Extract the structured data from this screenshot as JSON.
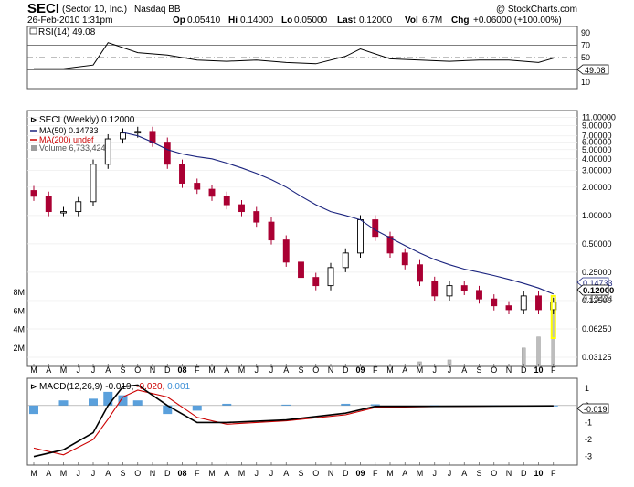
{
  "header": {
    "symbol": "SECI",
    "company": "(Sector 10, Inc.)",
    "exchange": "Nasdaq BB",
    "copyright": "@ StockCharts.com",
    "datetime": "26-Feb-2010 1:31pm",
    "op_label": "Op",
    "op": "0.05410",
    "hi_label": "Hi",
    "hi": "0.14000",
    "lo_label": "Lo",
    "lo": "0.05000",
    "last_label": "Last",
    "last": "0.12000",
    "vol_label": "Vol",
    "vol": "6.7M",
    "chg_label": "Chg",
    "chg": "+0.06000 (+100.00%)"
  },
  "rsi": {
    "label": "RSI(14) 49.08",
    "value_badge": "49.08",
    "levels": [
      "90",
      "70",
      "50",
      "30",
      "10"
    ]
  },
  "price_legend": {
    "line1": "SECI (Weekly) 0.12000",
    "line2": "MA(50) 0.14733",
    "line3": "MA(200) undef",
    "line4": "Volume 6,733,424"
  },
  "price_axis_labels": [
    "11.00000",
    "9.00000",
    "7.00000",
    "6.00000",
    "5.00000",
    "4.00000",
    "3.00000",
    "2.00000",
    "1.00000",
    "0.50000",
    "0.25000",
    "0.12500",
    "0.06250",
    "0.03125"
  ],
  "price_axis_values": [
    11,
    9,
    7,
    6,
    5,
    4,
    3,
    2,
    1,
    0.5,
    0.25,
    0.125,
    0.0625,
    0.03125
  ],
  "price_badges": {
    "ma": "0.14733",
    "last": "0.12000",
    "partial": "0.13424"
  },
  "volume_axis_labels": [
    "8M",
    "6M",
    "4M",
    "2M"
  ],
  "x_axis_labels": [
    "M",
    "A",
    "M",
    "J",
    "J",
    "A",
    "S",
    "O",
    "N",
    "D",
    "08",
    "F",
    "M",
    "A",
    "M",
    "J",
    "J",
    "A",
    "S",
    "O",
    "N",
    "D",
    "09",
    "F",
    "M",
    "A",
    "M",
    "J",
    "J",
    "A",
    "S",
    "O",
    "N",
    "D",
    "10",
    "F"
  ],
  "macd": {
    "label_prefix": "MACD(12,26,9)",
    "val1": "-0.019,",
    "val2": "-0.020,",
    "val3": "0.001",
    "badge": "-0.019",
    "levels": [
      "1",
      "0",
      "-1",
      "-2",
      "-3"
    ]
  },
  "colors": {
    "up": "#000000",
    "down": "#aa0033",
    "ma50": "#1a237e",
    "ma200": "#cc0000",
    "volume": "#bdbdbd",
    "volume_down": "#e57373",
    "macd_hist": "#3d8fd6",
    "signal": "#cc0000",
    "macd": "#000000",
    "highlight": "#ffff00"
  },
  "chart_data": [
    {
      "type": "line",
      "title": "RSI(14) 49.08",
      "ylim": [
        0,
        100
      ],
      "x": [
        "2007-03",
        "2007-05",
        "2007-07",
        "2007-08",
        "2007-10",
        "2007-12",
        "2008-02",
        "2008-04",
        "2008-06",
        "2008-08",
        "2008-10",
        "2008-12",
        "2009-01",
        "2009-03",
        "2009-05",
        "2009-07",
        "2009-09",
        "2009-11",
        "2010-01",
        "2010-02"
      ],
      "values": [
        32,
        32,
        38,
        74,
        58,
        54,
        46,
        44,
        46,
        42,
        40,
        52,
        64,
        48,
        46,
        44,
        46,
        46,
        42,
        49
      ]
    },
    {
      "type": "candlestick",
      "title": "SECI (Weekly) 0.12000",
      "scale": "log",
      "ylim": [
        0.025,
        13
      ],
      "x": [
        "2007-03",
        "2007-04",
        "2007-05",
        "2007-06",
        "2007-07",
        "2007-08",
        "2007-09",
        "2007-10",
        "2007-11",
        "2007-12",
        "2008-01",
        "2008-02",
        "2008-03",
        "2008-04",
        "2008-05",
        "2008-06",
        "2008-07",
        "2008-08",
        "2008-09",
        "2008-10",
        "2008-11",
        "2008-12",
        "2009-01",
        "2009-02",
        "2009-03",
        "2009-04",
        "2009-05",
        "2009-06",
        "2009-07",
        "2009-08",
        "2009-09",
        "2009-10",
        "2009-11",
        "2009-12",
        "2010-01",
        "2010-02"
      ],
      "values": [
        1.6,
        1.1,
        1.1,
        1.4,
        3.5,
        6.5,
        7.5,
        7.8,
        6.0,
        3.5,
        2.2,
        1.9,
        1.6,
        1.3,
        1.1,
        0.85,
        0.55,
        0.32,
        0.22,
        0.18,
        0.28,
        0.4,
        0.9,
        0.6,
        0.4,
        0.3,
        0.2,
        0.14,
        0.18,
        0.16,
        0.13,
        0.11,
        0.1,
        0.14,
        0.1,
        0.12
      ],
      "series": [
        {
          "name": "MA(50) 0.14733",
          "values": [
            null,
            null,
            null,
            null,
            null,
            null,
            7.6,
            7.0,
            6.0,
            5.0,
            4.5,
            4.2,
            4.0,
            3.6,
            3.2,
            2.8,
            2.4,
            2.0,
            1.6,
            1.3,
            1.1,
            1.0,
            0.9,
            0.7,
            0.58,
            0.48,
            0.4,
            0.34,
            0.3,
            0.27,
            0.25,
            0.23,
            0.21,
            0.19,
            0.17,
            0.147
          ]
        }
      ]
    },
    {
      "type": "bar",
      "title": "Volume 6,733,424",
      "ylim": [
        0,
        10000000
      ],
      "x": [
        "2009-05",
        "2009-07",
        "2009-12",
        "2010-01",
        "2010-02"
      ],
      "values": [
        500000,
        700000,
        2000000,
        3200000,
        6733424
      ]
    },
    {
      "type": "line",
      "title": "MACD(12,26,9) -0.019, -0.020, 0.001",
      "ylim": [
        -3.5,
        1.6
      ],
      "x": [
        "2007-03",
        "2007-05",
        "2007-07",
        "2007-08",
        "2007-09",
        "2007-10",
        "2007-12",
        "2008-02",
        "2008-04",
        "2008-08",
        "2008-12",
        "2009-02",
        "2009-06",
        "2009-10",
        "2010-02"
      ],
      "series": [
        {
          "name": "MACD(12,26,9)",
          "values": [
            -3.0,
            -2.6,
            -1.6,
            0.0,
            1.1,
            1.2,
            0.0,
            -1.0,
            -1.0,
            -0.85,
            -0.45,
            -0.05,
            -0.05,
            -0.03,
            -0.019
          ]
        },
        {
          "name": "Signal",
          "values": [
            -2.5,
            -2.9,
            -2.0,
            -0.8,
            0.5,
            0.9,
            0.5,
            -0.7,
            -1.1,
            -0.9,
            -0.55,
            -0.12,
            -0.06,
            -0.04,
            -0.02
          ]
        },
        {
          "name": "Histogram",
          "values": [
            -0.5,
            0.3,
            0.4,
            0.8,
            0.6,
            0.3,
            -0.5,
            -0.3,
            0.1,
            0.05,
            0.1,
            0.07,
            0.01,
            0.01,
            0.001
          ]
        }
      ]
    }
  ]
}
